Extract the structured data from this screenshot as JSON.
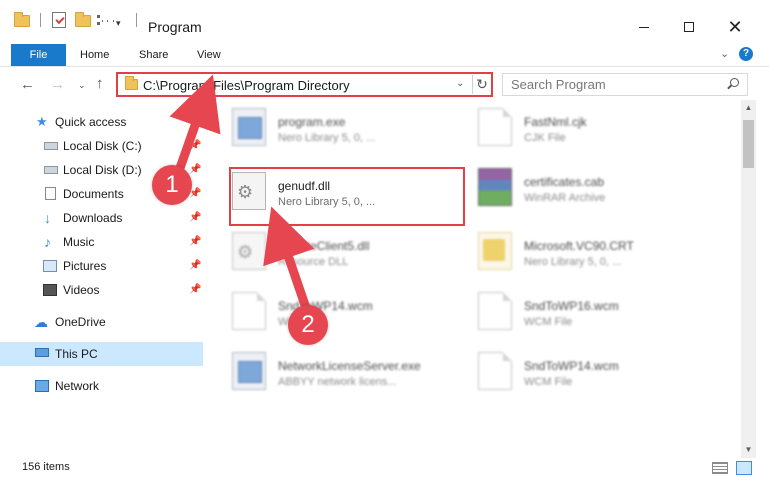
{
  "window": {
    "title": "Program",
    "minimize_icon": "minimize-icon",
    "maximize_icon": "maximize-icon",
    "close_glyph": "✕",
    "qa_dropdown_glyph": "▾"
  },
  "ribbon": {
    "tabs": [
      {
        "label": "File"
      },
      {
        "label": "Home"
      },
      {
        "label": "Share"
      },
      {
        "label": "View"
      }
    ],
    "expand_glyph": "⌄",
    "help_glyph": "?",
    "accent_color": "#1979ca"
  },
  "nav": {
    "back_glyph": "←",
    "forward_glyph": "→",
    "recent_glyph": "⌄",
    "up_glyph": "↑"
  },
  "address": {
    "path": "C:\\Program Files\\Program Directory",
    "dropdown_glyph": "⌄",
    "refresh_glyph": "↻",
    "highlight_color": "#e1404a"
  },
  "search": {
    "placeholder": "Search Program"
  },
  "sidebar": {
    "pin_glyph": "📌",
    "items": [
      {
        "label": "Quick access",
        "icon": "star-icon",
        "glyph": "★"
      },
      {
        "label": "Local Disk (C:)",
        "icon": "disk-icon"
      },
      {
        "label": "Local Disk (D:)",
        "icon": "disk-icon"
      },
      {
        "label": "Documents",
        "icon": "documents-icon"
      },
      {
        "label": "Downloads",
        "icon": "download-icon",
        "glyph": "↓"
      },
      {
        "label": "Music",
        "icon": "music-icon",
        "glyph": "♪"
      },
      {
        "label": "Pictures",
        "icon": "pictures-icon"
      },
      {
        "label": "Videos",
        "icon": "videos-icon"
      },
      {
        "label": "OneDrive",
        "icon": "cloud-icon",
        "glyph": "☁"
      },
      {
        "label": "This PC",
        "icon": "computer-icon",
        "selected": true
      },
      {
        "label": "Network",
        "icon": "network-icon"
      }
    ]
  },
  "files": [
    {
      "name": "program.exe",
      "type": "Nero Library 5, 0, ...",
      "icon": "exe-icon"
    },
    {
      "name": "FastNml.cjk",
      "type": "CJK File",
      "icon": "file-icon"
    },
    {
      "name": "genudf.dll",
      "type": "Nero Library 5, 0, ...",
      "icon": "dll-gear-icon",
      "highlighted": true
    },
    {
      "name": "certificates.cab",
      "type": "WinRAR Archive",
      "icon": "winrar-icon"
    },
    {
      "name": "UpdateClient5.dll",
      "type": "Resource DLL",
      "icon": "dll-gear-icon"
    },
    {
      "name": "Microsoft.VC90.CRT",
      "type": "Nero Library 5, 0, ...",
      "icon": "folder-file-icon"
    },
    {
      "name": "SndToWP14.wcm",
      "type": "WCM File",
      "icon": "file-icon"
    },
    {
      "name": "SndToWP16.wcm",
      "type": "WCM File",
      "icon": "file-icon"
    },
    {
      "name": "NetworkLicenseServer.exe",
      "type": "ABBYY network licens...",
      "icon": "exe-icon"
    },
    {
      "name": "SndToWP14.wcm",
      "type": "WCM File",
      "icon": "file-icon"
    }
  ],
  "annotations": {
    "step1": "1",
    "step2": "2",
    "badge_color": "#e6464f"
  },
  "scrollbar": {
    "up_glyph": "▲",
    "down_glyph": "▼"
  },
  "status": {
    "item_count": "156 items"
  }
}
